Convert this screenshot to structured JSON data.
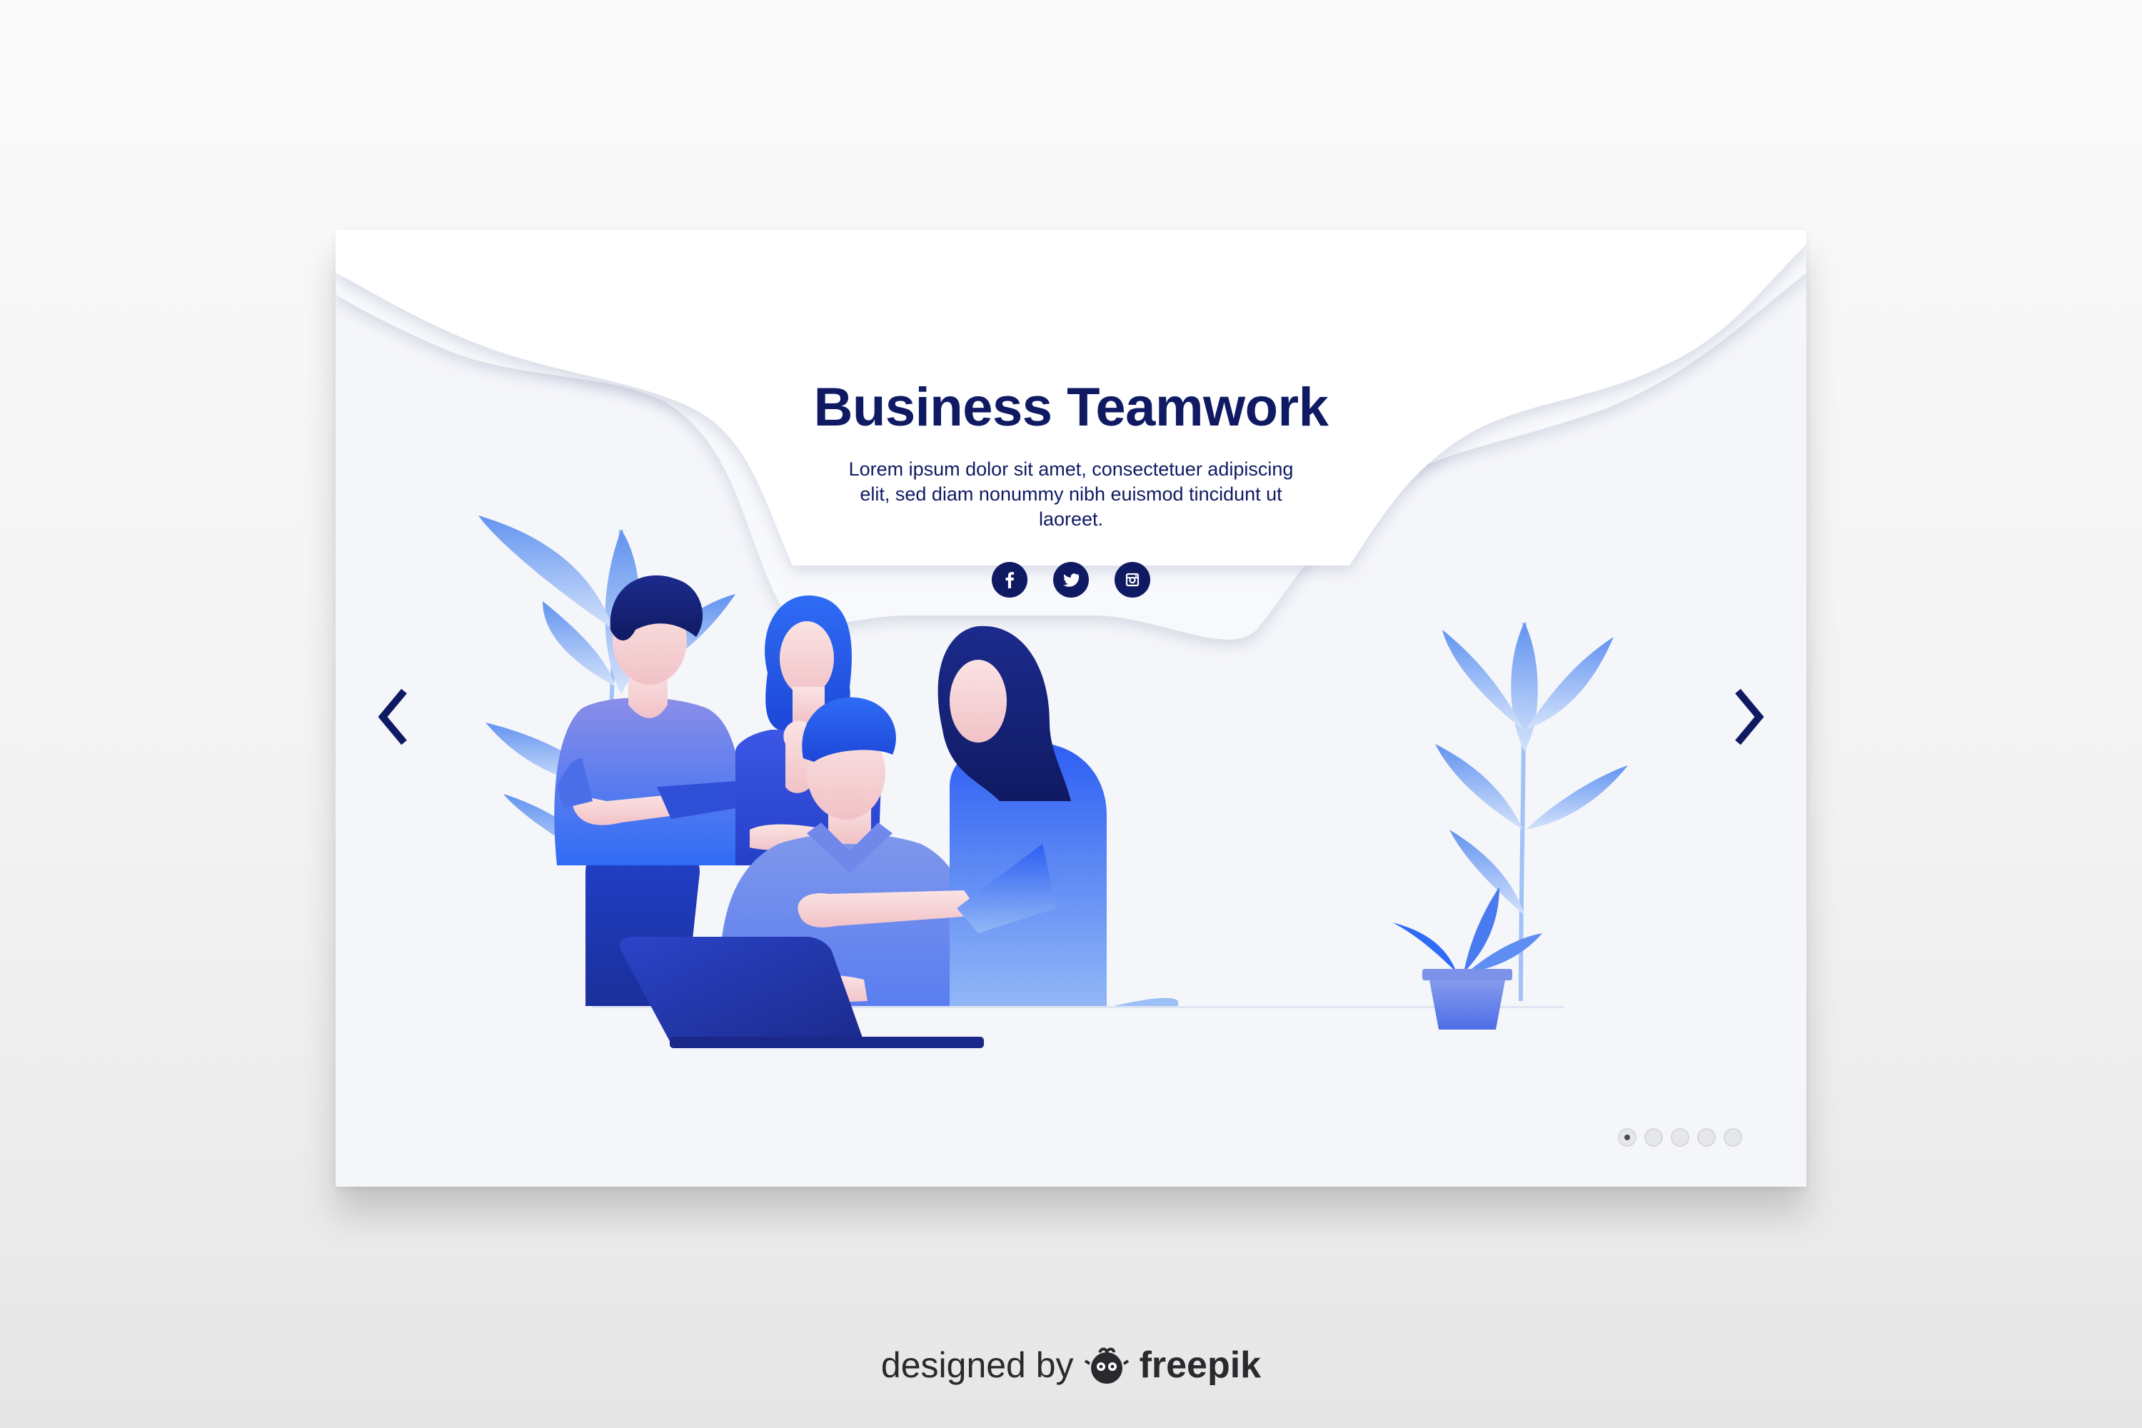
{
  "hero": {
    "title": "Business Teamwork",
    "description": "Lorem ipsum dolor sit amet, consectetuer adipiscing elit, sed diam nonummy nibh euismod tincidunt ut laoreet."
  },
  "social": [
    {
      "name": "facebook",
      "icon": "facebook-icon"
    },
    {
      "name": "twitter",
      "icon": "twitter-icon"
    },
    {
      "name": "instagram",
      "icon": "instagram-icon"
    }
  ],
  "carousel": {
    "prev_icon": "chevron-left-icon",
    "next_icon": "chevron-right-icon",
    "slide_count": 5,
    "active_slide": 1
  },
  "credit": {
    "prefix": "designed by",
    "brand": "freepik"
  },
  "colors": {
    "navy": "#101a63",
    "primary_blue": "#2f5ff0",
    "light_blue": "#7fb0f4",
    "background": "#f5f6fa"
  }
}
